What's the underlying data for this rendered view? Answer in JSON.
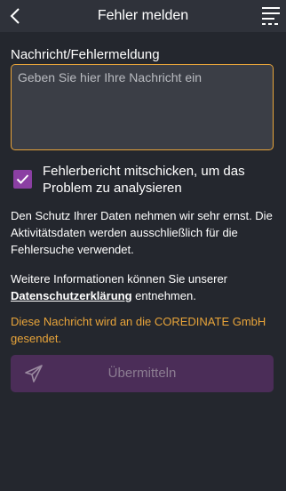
{
  "header": {
    "title": "Fehler melden",
    "back_icon": "chevron-left-icon",
    "menu_icon": "menu-icon"
  },
  "form": {
    "message_label": "Nachricht/Fehlermeldung",
    "message_placeholder": "Geben Sie hier Ihre Nachricht ein",
    "message_value": ""
  },
  "checkbox": {
    "label": "Fehlerbericht mitschicken, um das Problem zu analysieren",
    "checked": true
  },
  "privacy": {
    "text": "Den Schutz Ihrer Daten nehmen wir sehr ernst. Die Aktivitätsdaten werden ausschließlich für die Fehlersuche verwendet.",
    "more_prefix": "Weitere Informationen können Sie unserer",
    "link_text": "Datenschutzerklärung",
    "more_suffix": "entnehmen."
  },
  "notice": "Diese Nachricht wird an die COREDINATE GmbH gesendet.",
  "submit": {
    "label": "Übermitteln",
    "icon": "send-icon"
  },
  "colors": {
    "background": "#24272e",
    "header": "#2f323a",
    "accent_orange": "#e8a43a",
    "accent_purple": "#8b3fa3",
    "button_disabled": "#4b2d58"
  }
}
